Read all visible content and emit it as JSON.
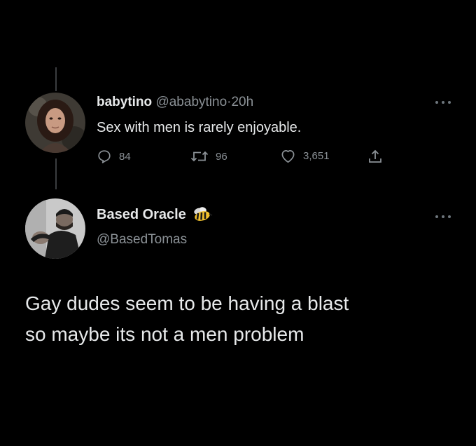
{
  "reply_tweet": {
    "display_name": "babytino",
    "handle": "@ababytino",
    "separator": "·",
    "time": "20h",
    "text": "Sex with men is rarely enjoyable.",
    "actions": {
      "replies": "84",
      "retweets": "96",
      "likes": "3,651"
    },
    "icons": [
      "reply-icon",
      "retweet-icon",
      "heart-icon",
      "share-icon",
      "more-icon"
    ]
  },
  "main_tweet": {
    "display_name": "Based Oracle",
    "handle": "@BasedTomas",
    "badge_icon": "bee-icon",
    "text_line1": "Gay dudes seem to be having a blast",
    "text_line2": "so maybe its not a men problem"
  },
  "colors": {
    "background": "#000000",
    "text": "#e7e9ea",
    "muted": "#8b9196",
    "thread_line": "#3a3d40"
  }
}
